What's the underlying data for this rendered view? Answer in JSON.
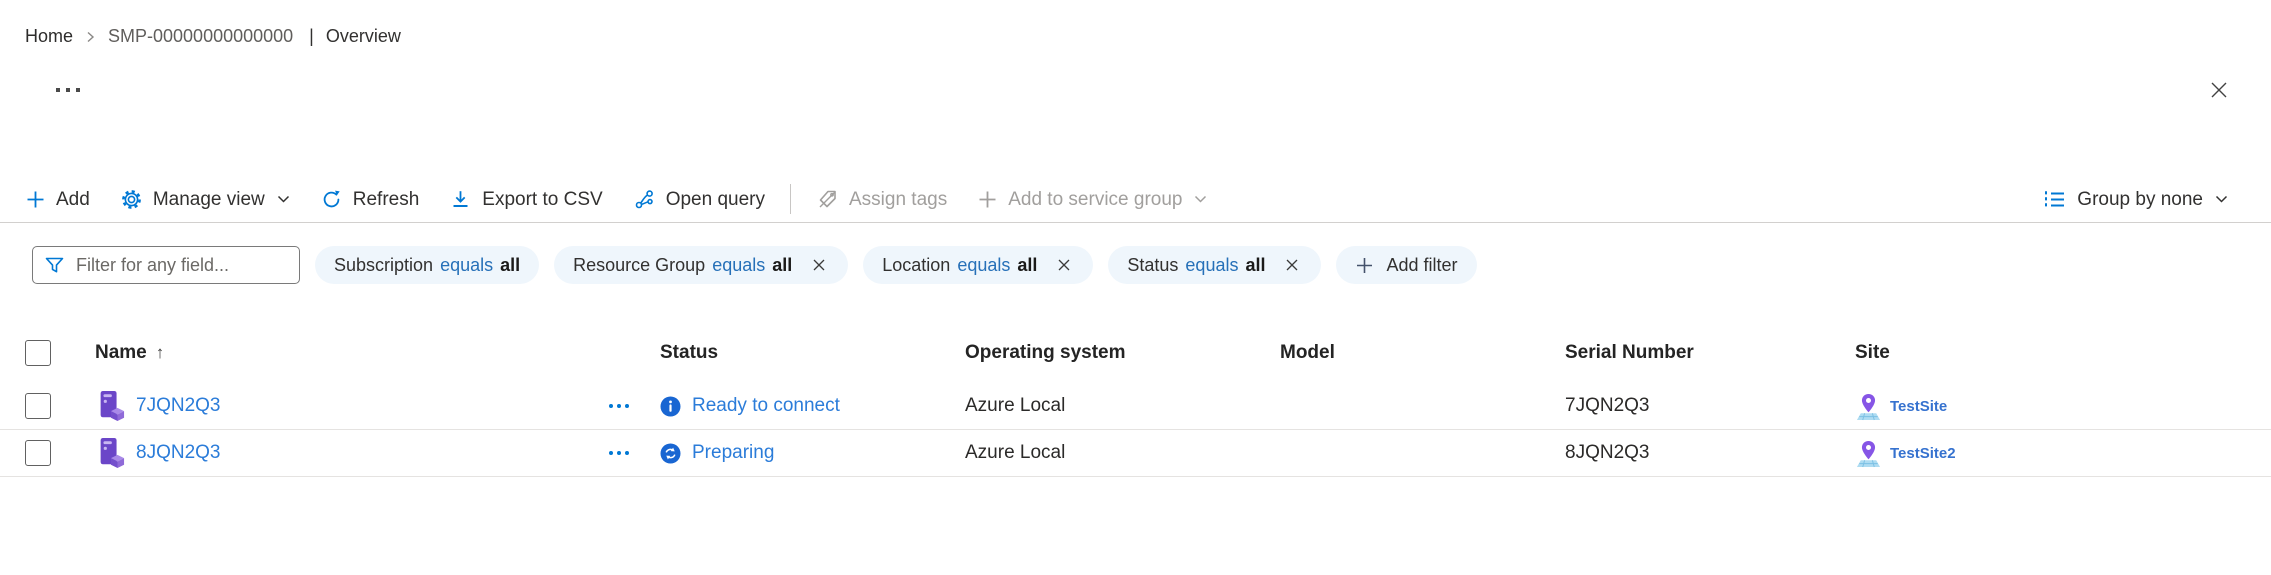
{
  "breadcrumb": {
    "home": "Home",
    "resource": "SMP-00000000000000",
    "pipe": "|",
    "section": "Overview"
  },
  "toolbar": {
    "add": "Add",
    "manage_view": "Manage view",
    "refresh": "Refresh",
    "export_csv": "Export to CSV",
    "open_query": "Open query",
    "assign_tags": "Assign tags",
    "add_to_service_group": "Add to service group",
    "group_by": "Group by none"
  },
  "filters": {
    "search_placeholder": "Filter for any field...",
    "pills": [
      {
        "field": "Subscription",
        "operator": "equals",
        "value": "all",
        "dismissible": false
      },
      {
        "field": "Resource Group",
        "operator": "equals",
        "value": "all",
        "dismissible": true
      },
      {
        "field": "Location",
        "operator": "equals",
        "value": "all",
        "dismissible": true
      },
      {
        "field": "Status",
        "operator": "equals",
        "value": "all",
        "dismissible": true
      }
    ],
    "add_filter": "Add filter"
  },
  "table": {
    "columns": {
      "name": "Name",
      "status": "Status",
      "os": "Operating system",
      "model": "Model",
      "serial": "Serial Number",
      "site": "Site"
    },
    "sort_indicator": "↑",
    "rows": [
      {
        "name": "7JQN2Q3",
        "status": "Ready to connect",
        "status_icon": "info-circle-blue",
        "os": "Azure Local",
        "model": "",
        "serial": "7JQN2Q3",
        "site": "TestSite"
      },
      {
        "name": "8JQN2Q3",
        "status": "Preparing",
        "status_icon": "sync-circle-blue",
        "os": "Azure Local",
        "model": "",
        "serial": "8JQN2Q3",
        "site": "TestSite2"
      }
    ]
  },
  "icons": {
    "add": "plus",
    "manage_view": "gear",
    "refresh": "circular-arrow",
    "export_csv": "download-arrow",
    "open_query": "flow-branch",
    "assign_tags": "tag-slash",
    "group_by": "grouped-list",
    "chevron": "chevron-down",
    "filter": "funnel",
    "close": "x",
    "dismiss": "x",
    "sort": "arrow-up",
    "more_options": "ellipsis-horizontal",
    "device": "server-purple-cube",
    "site": "map-pin-purple"
  },
  "colors": {
    "accent": "#0078d4",
    "link": "#2b7cd9",
    "operator_blue": "#2670b8",
    "status_icon_blue": "#1966d2",
    "disabled": "#a19f9d",
    "text": "#323130",
    "pill_bg": "#eff6fc",
    "row_border": "#e5e3e1",
    "device_purple": "#6b46c8",
    "site_pin_purple": "#8655e6"
  }
}
